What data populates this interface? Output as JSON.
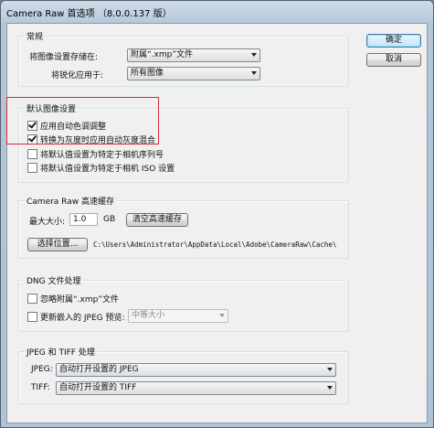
{
  "window": {
    "title": "Camera Raw 首选项 （8.0.0.137 版）"
  },
  "buttons": {
    "ok": "确定",
    "cancel": "取消"
  },
  "general": {
    "legend": "常规",
    "save_label": "将图像设置存储在:",
    "save_value": "附属“.xmp”文件",
    "sharpen_label": "将锐化应用于:",
    "sharpen_value": "所有图像"
  },
  "defaults": {
    "legend": "默认图像设置",
    "items": [
      {
        "label": "应用自动色调调整",
        "checked": true
      },
      {
        "label": "转换为灰度时应用自动灰度混合",
        "checked": true
      },
      {
        "label": "将默认值设置为特定于相机序列号",
        "checked": false
      },
      {
        "label": "将默认值设置为特定于相机 ISO 设置",
        "checked": false
      }
    ]
  },
  "cache": {
    "legend": "Camera Raw 高速缓存",
    "size_label": "最大大小:",
    "size_value": "1.0",
    "size_unit": "GB",
    "purge_button": "清空高速缓存",
    "location_button": "选择位置...",
    "path": "C:\\Users\\Administrator\\AppData\\Local\\Adobe\\CameraRaw\\Cache\\"
  },
  "dng": {
    "legend": "DNG 文件处理",
    "ignore_label": "忽略附属“.xmp”文件",
    "update_label": "更新嵌入的 JPEG 预览:",
    "preview_value": "中等大小"
  },
  "jpeg_tiff": {
    "legend": "JPEG 和 TIFF 处理",
    "jpeg_label": "JPEG:",
    "jpeg_value": "自动打开设置的 JPEG",
    "tiff_label": "TIFF:",
    "tiff_value": "自动打开设置的 TIFF"
  },
  "colors": {
    "highlight": "#d6283b"
  }
}
